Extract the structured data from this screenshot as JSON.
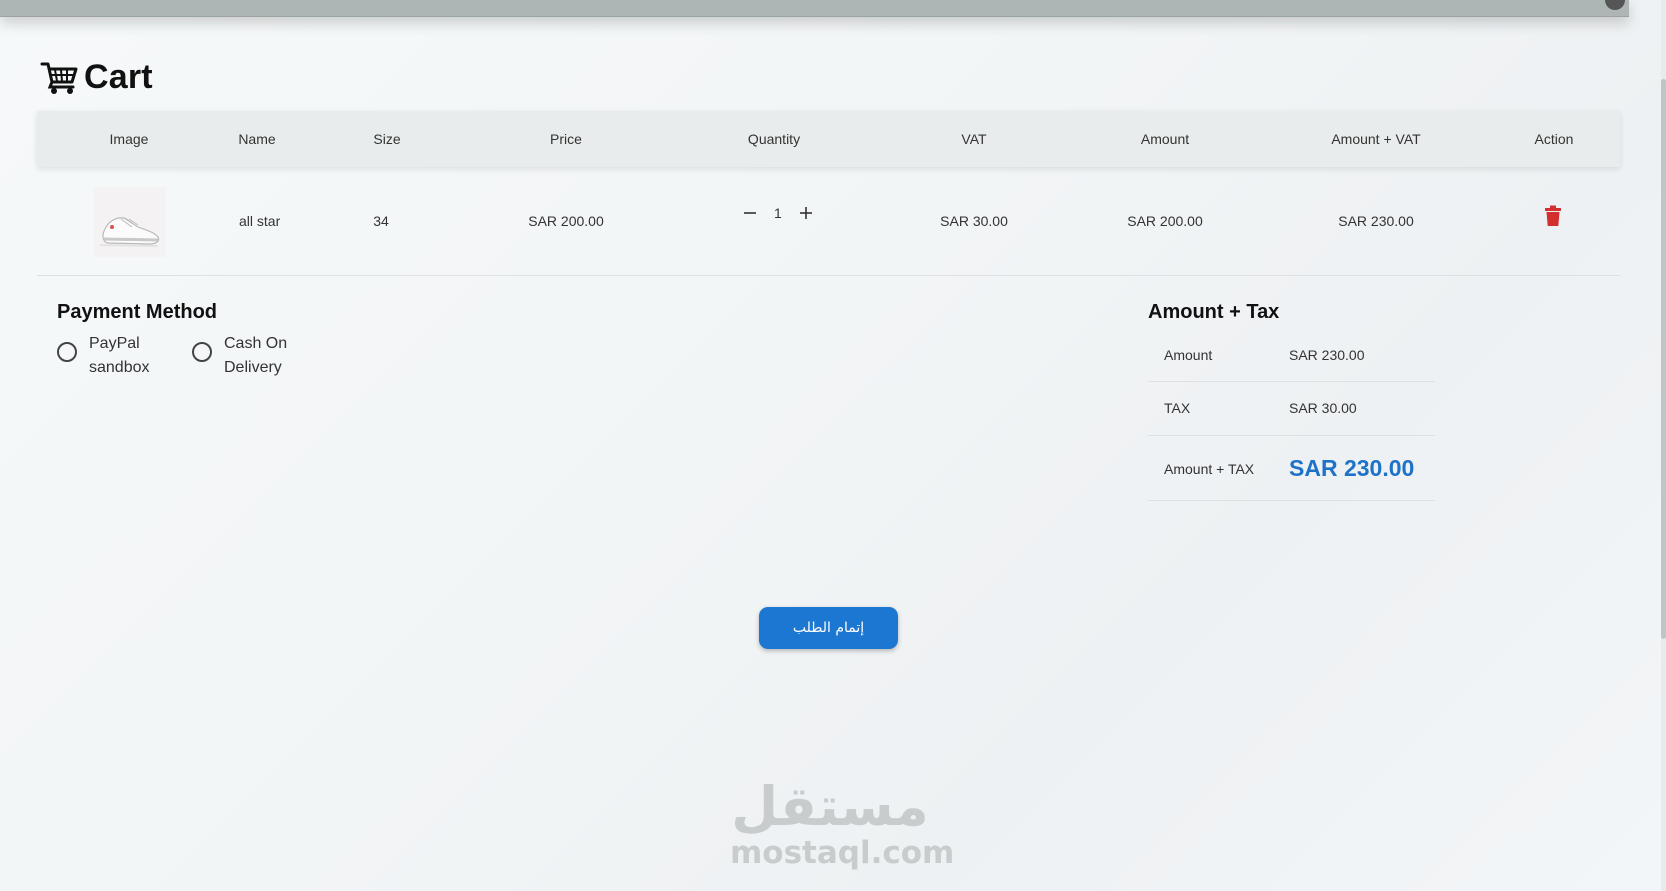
{
  "page": {
    "title": "Cart"
  },
  "table": {
    "headers": {
      "image": "Image",
      "name": "Name",
      "size": "Size",
      "price": "Price",
      "quantity": "Quantity",
      "vat": "VAT",
      "amount": "Amount",
      "amount_vat": "Amount + VAT",
      "action": "Action"
    },
    "rows": [
      {
        "image": "sneaker-image",
        "name": "all star",
        "size": "34",
        "price": "SAR 200.00",
        "quantity": "1",
        "vat": "SAR 30.00",
        "amount": "SAR 200.00",
        "amount_vat": "SAR 230.00",
        "action_icon": "trash-icon"
      }
    ]
  },
  "payment": {
    "title": "Payment Method",
    "options": [
      {
        "line1": "PayPal",
        "line2": "sandbox",
        "selected": false
      },
      {
        "line1": "Cash On",
        "line2": "Delivery",
        "selected": false
      }
    ]
  },
  "summary": {
    "title": "Amount + Tax",
    "rows": [
      {
        "label": "Amount",
        "value": "SAR 230.00"
      },
      {
        "label": "TAX",
        "value": "SAR 30.00"
      },
      {
        "label": "Amount + TAX",
        "value": "SAR 230.00"
      }
    ]
  },
  "submit_label": "إتمام الطلب",
  "watermark": {
    "arabic": "مستقل",
    "latin": "mostaql.com"
  },
  "colors": {
    "accent": "#1c77d2",
    "total": "#1e73c7",
    "delete": "#d32f2f"
  }
}
